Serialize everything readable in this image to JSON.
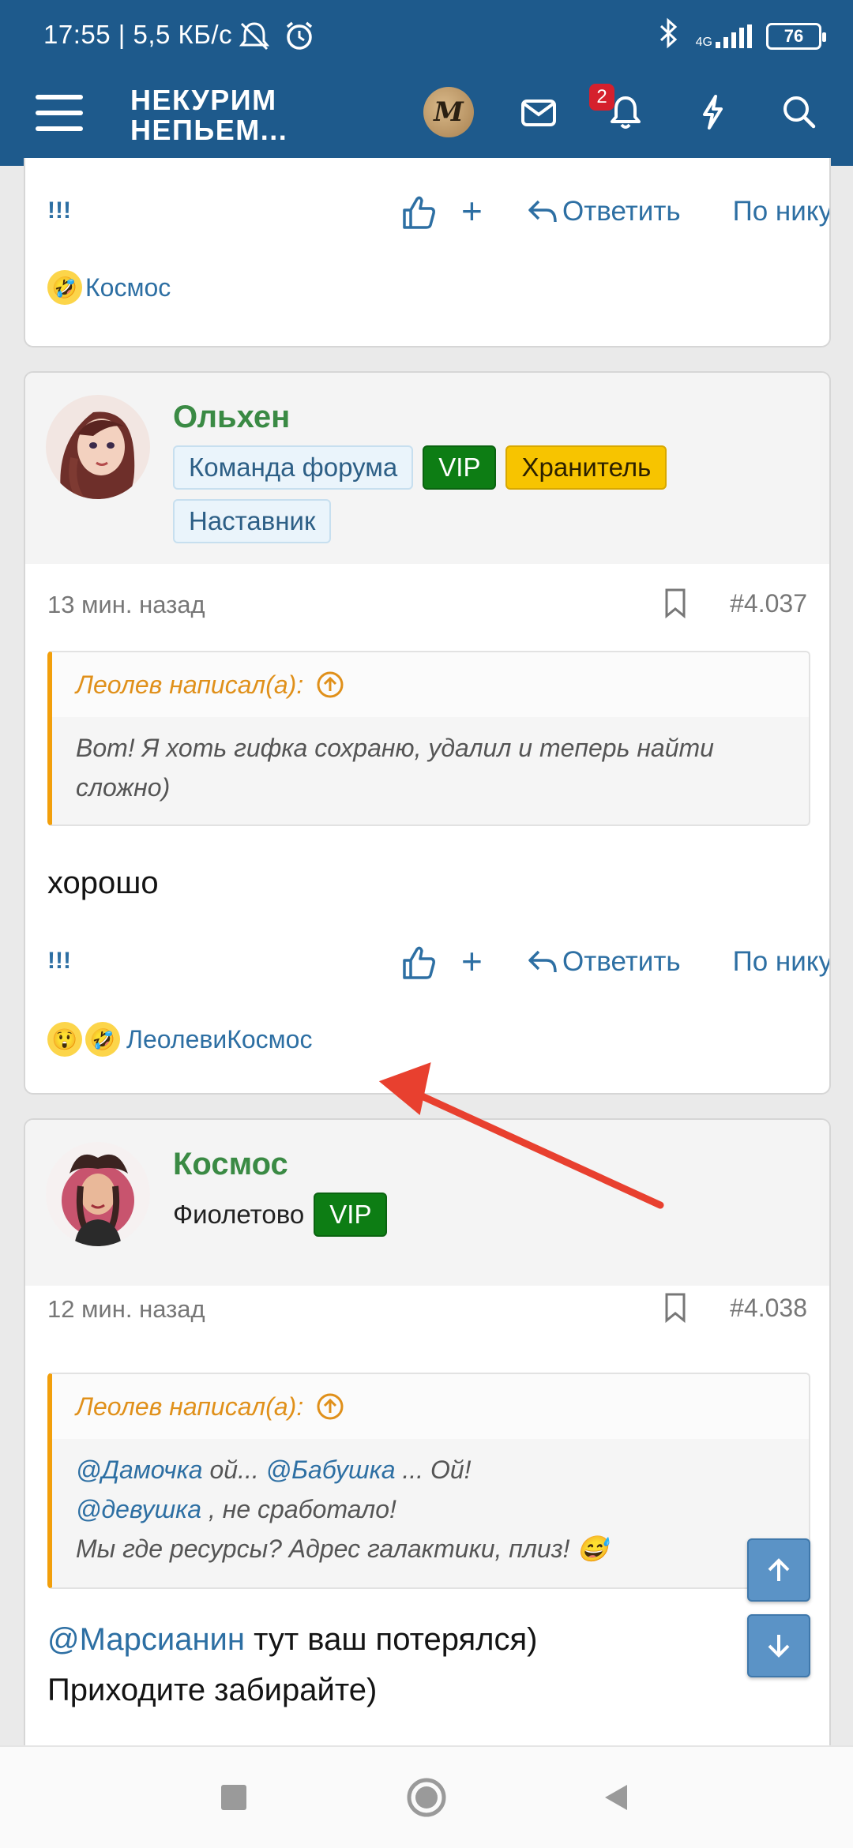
{
  "status_bar": {
    "time_speed": "17:55 | 5,5 КБ/с",
    "net_type": "4G",
    "battery": "76"
  },
  "header": {
    "site_title_line1": "НЕКУРИМ",
    "site_title_line2": "НЕПЬЕМ...",
    "avatar_letter": "M",
    "notification_count": "2"
  },
  "post_top": {
    "report_label": "!!!",
    "reply_label": "Ответить",
    "by_nick_label": "По нику",
    "reaction_users": "Космос"
  },
  "post_1": {
    "username": "Ольхен",
    "badges": [
      "Команда форума",
      "VIP",
      "Хранитель",
      "Наставник"
    ],
    "time": "13 мин. назад",
    "post_number": "#4.037",
    "quote_author": "Леолев написал(а):",
    "quote_text": "Вот! Я хоть гифка сохраню, удалил и теперь найти сложно)",
    "text": "хорошо",
    "report_label": "!!!",
    "reply_label": "Ответить",
    "by_nick_label": "По нику",
    "reaction_user1": "Леолев",
    "reaction_and": "и",
    "reaction_user2": "Космос"
  },
  "post_2": {
    "username": "Космос",
    "user_title": "Фиолетово",
    "badge": "VIP",
    "time": "12 мин. назад",
    "post_number": "#4.038",
    "quote_author": "Леолев написал(а):",
    "quote_line1_mention1": "@Дамочка",
    "quote_line1_text1": " ой... ",
    "quote_line1_mention2": "@Бабушка",
    "quote_line1_text2": " ... Ой!",
    "quote_line2_mention": "@девушка",
    "quote_line2_text": " , не сработало!",
    "quote_line3": "Мы где ресурсы? Адрес галактики, плиз! 😅",
    "text_mention": "@Марсианин",
    "text_line1": " тут ваш потерялся)",
    "text_line2": "Приходите забирайте)"
  },
  "colors": {
    "header_bg": "#1e5a8c",
    "username_green": "#3a8a44",
    "link_blue": "#2d6fa3",
    "quote_accent": "#f29f0b",
    "vip_green": "#0d7d14",
    "gold": "#f7c400",
    "arrow_red": "#e8402f"
  }
}
